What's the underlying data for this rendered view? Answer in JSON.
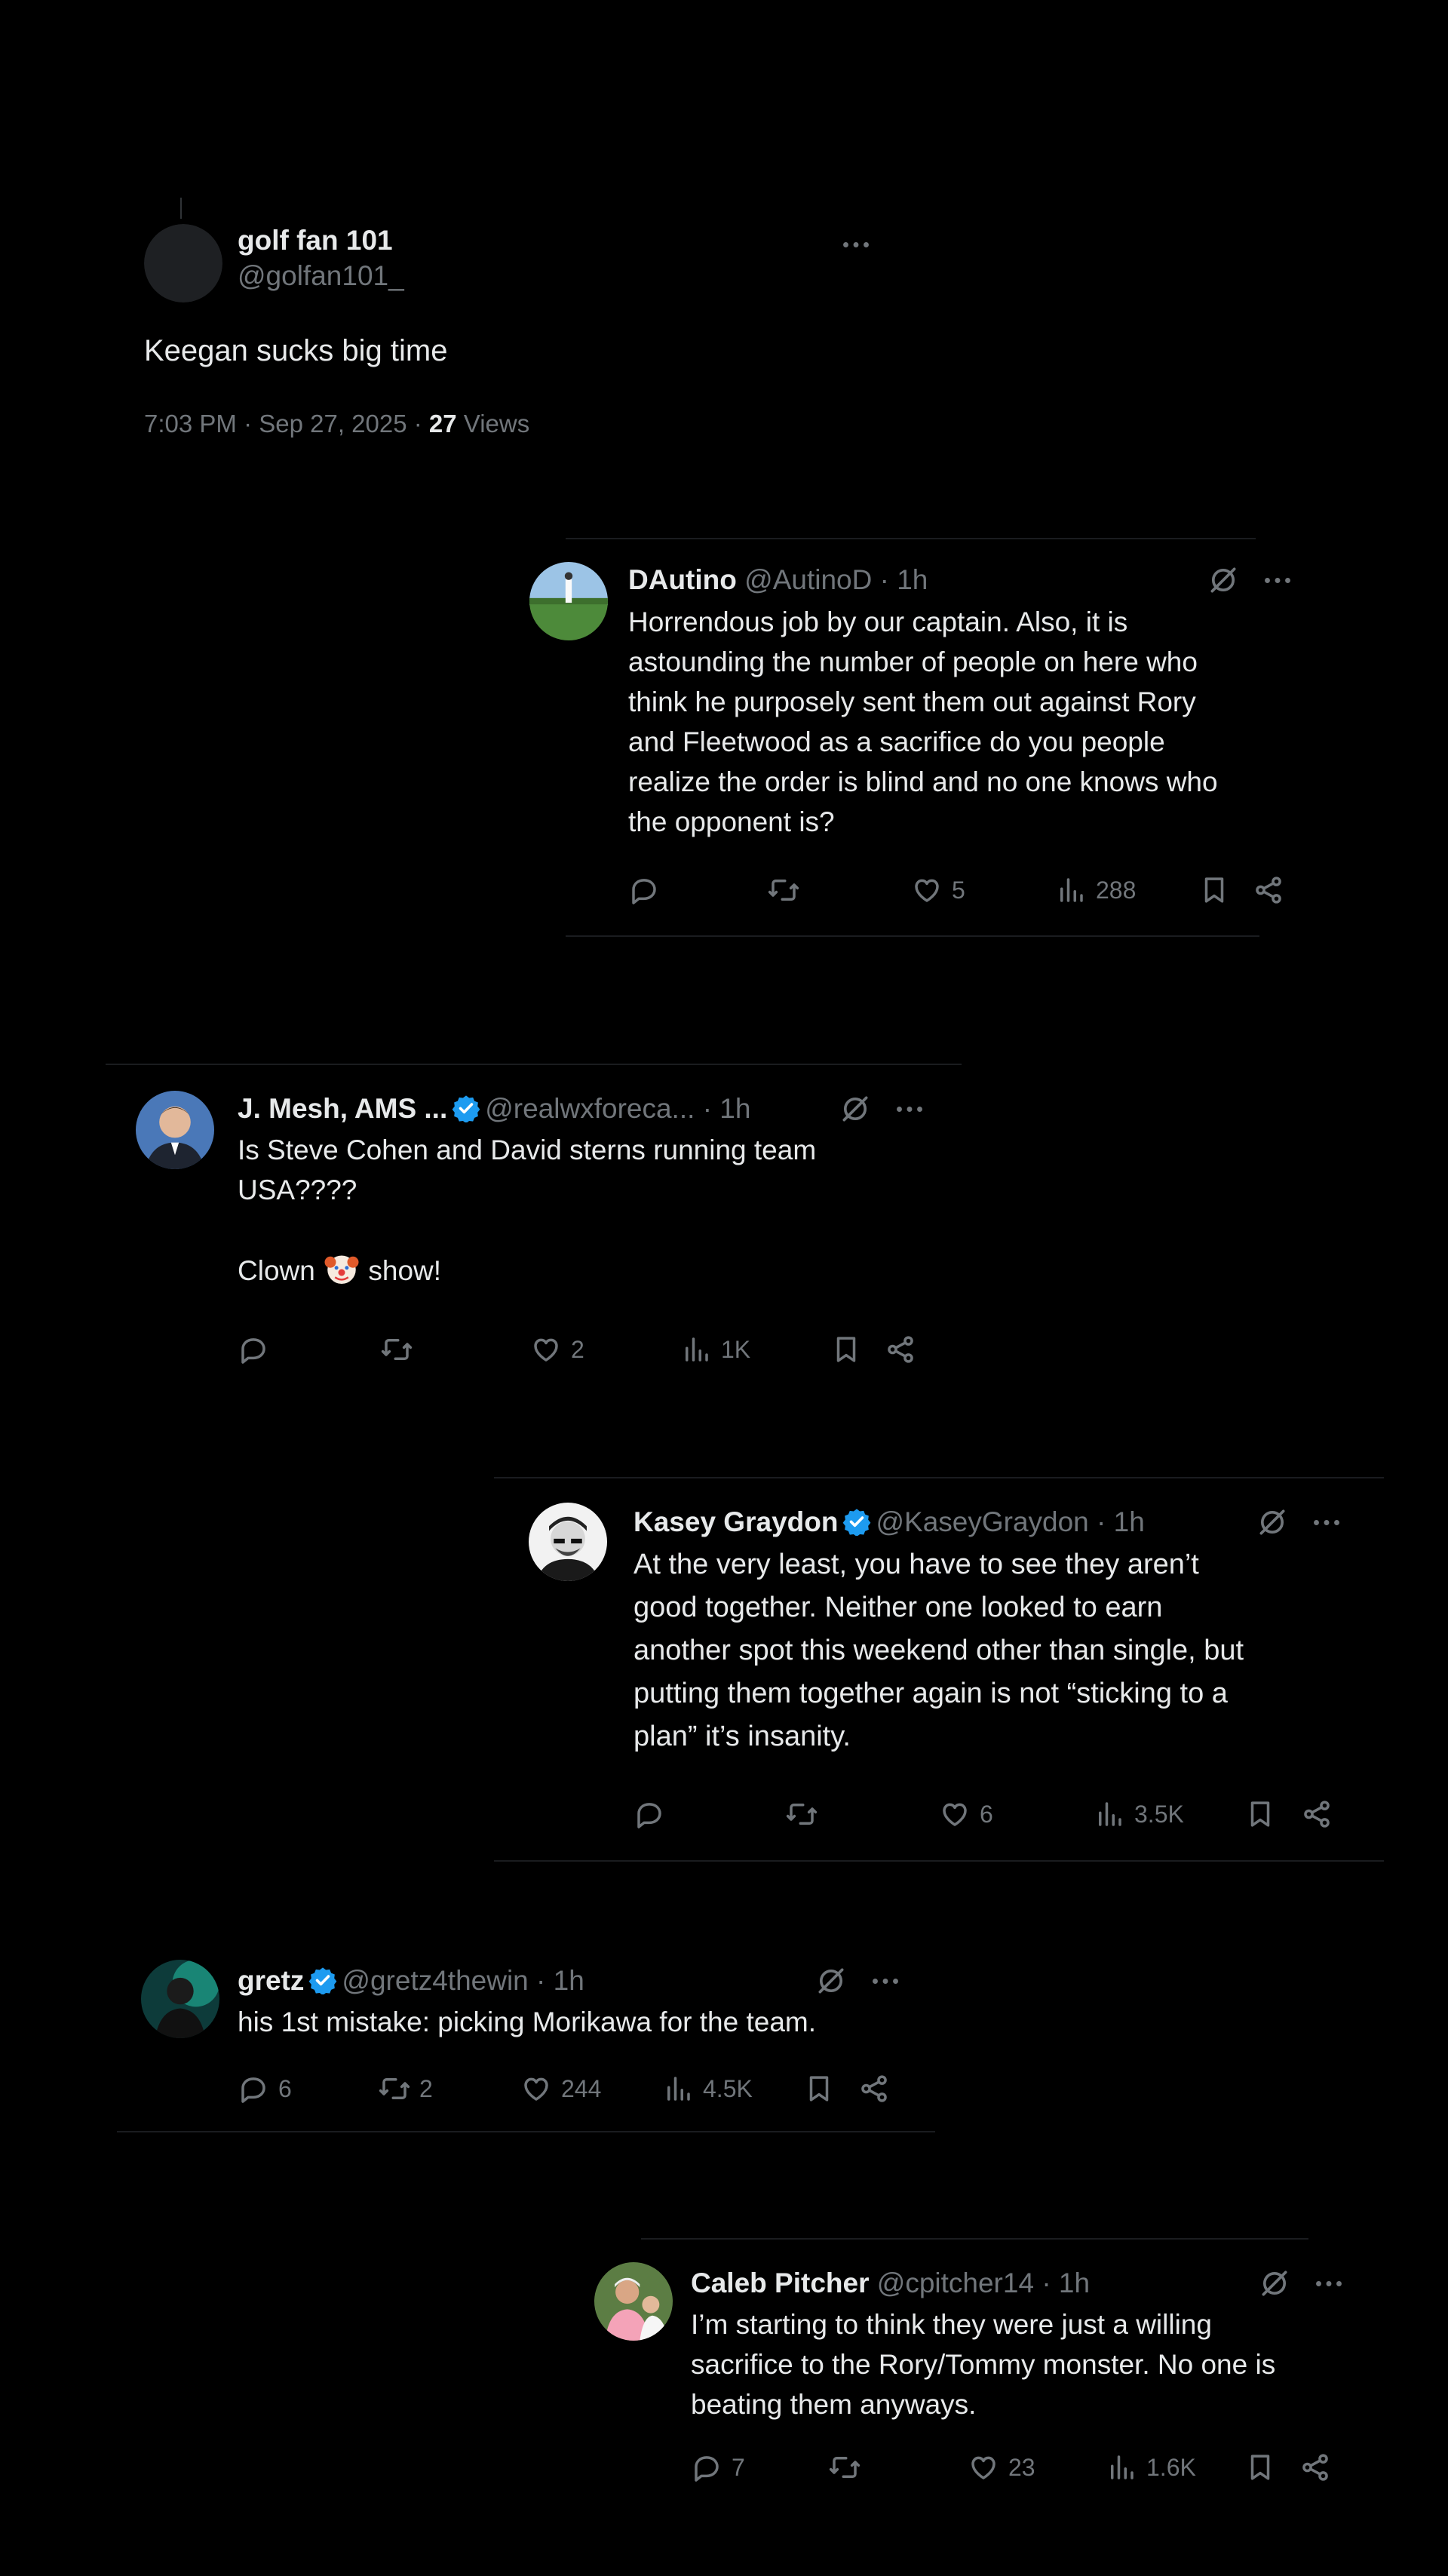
{
  "main_post": {
    "name": "golf fan 101",
    "handle": "@golfan101_",
    "text": "Keegan sucks big time",
    "timestamp": "7:03 PM · Sep 27, 2025 · ",
    "views_count": "27",
    "views_label": " Views"
  },
  "replies": [
    {
      "name": "DAutino",
      "handle": "@AutinoD",
      "time": "· 1h",
      "verified": false,
      "text": "Horrendous job by our captain. Also, it is\nastounding the number of people on here who\nthink he purposely sent them out against Rory\nand Fleetwood as a sacrifice do you people\nrealize the order is blind and no one knows who\nthe opponent is?",
      "replies_count": "",
      "reposts_count": "",
      "likes_count": "5",
      "views_count": "288"
    },
    {
      "name": "J. Mesh, AMS ...",
      "handle": "@realwxforeca...",
      "time": "· 1h",
      "verified": true,
      "text_line1": "Is Steve Cohen and David sterns running team",
      "text_line2": "USA????",
      "text_before_emoji": "Clown ",
      "emoji": "clown-face",
      "text_after_emoji": " show!",
      "replies_count": "",
      "reposts_count": "",
      "likes_count": "2",
      "views_count": "1K"
    },
    {
      "name": "Kasey Graydon",
      "handle": "@KaseyGraydon",
      "time": "· 1h",
      "verified": true,
      "text": "At the very least, you have to see they aren’t\ngood together. Neither one looked to earn\nanother spot this weekend other than single, but\nputting them together again is not “sticking to a\nplan” it’s insanity.",
      "replies_count": "",
      "reposts_count": "",
      "likes_count": "6",
      "views_count": "3.5K"
    },
    {
      "name": "gretz",
      "handle": "@gretz4thewin",
      "time": "· 1h",
      "verified": true,
      "text": "his 1st mistake: picking Morikawa for the team.",
      "replies_count": "6",
      "reposts_count": "2",
      "likes_count": "244",
      "views_count": "4.5K"
    },
    {
      "name": "Caleb Pitcher",
      "handle": "@cpitcher14",
      "time": "· 1h",
      "verified": false,
      "text": "I’m starting to think they were just a willing\nsacrifice to the Rory/Tommy monster. No one is\nbeating them anyways.",
      "replies_count": "7",
      "reposts_count": "",
      "likes_count": "23",
      "views_count": "1.6K"
    }
  ],
  "colors": {
    "background": "#000000",
    "text_primary": "#e7e9ea",
    "text_secondary": "#71767b",
    "verified_blue": "#1d9bf0"
  },
  "icons": [
    "more-icon",
    "grok-icon",
    "reply-icon",
    "repost-icon",
    "like-icon",
    "views-icon",
    "bookmark-icon",
    "share-icon",
    "verified-badge-icon"
  ]
}
